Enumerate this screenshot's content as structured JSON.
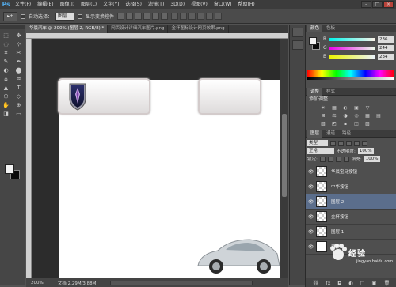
{
  "app": {
    "logo": "Ps",
    "menu": [
      "文件(F)",
      "编辑(E)",
      "图像(I)",
      "图层(L)",
      "文字(Y)",
      "选择(S)",
      "滤镜(T)",
      "3D(D)",
      "视图(V)",
      "窗口(W)",
      "帮助(H)"
    ],
    "window_buttons": [
      "–",
      "□",
      "×"
    ]
  },
  "options": {
    "tool_preset": "▸+",
    "auto_select_label": "自动选择：",
    "auto_select_value": "图层",
    "transform_label": "显示变换控件"
  },
  "tools": [
    "⬚",
    "✥",
    "◌",
    "⊹",
    "⌗",
    "✂",
    "✎",
    "✒",
    "◐",
    "⬤",
    "⌂",
    "♒",
    "▲",
    "T",
    "⬡",
    "◇",
    "✋",
    "⊕",
    "◨",
    "▭"
  ],
  "document": {
    "tabs": [
      {
        "label": "华晨汽车 @ 200% (图层 2, RGB/8) *",
        "active": true
      },
      {
        "label": "网页设计详细汽车图片.png",
        "active": false
      },
      {
        "label": "金杯图标设计网页效果.png",
        "active": false
      }
    ]
  },
  "status": {
    "zoom": "200%",
    "doc_size": "文档:2.29M/3.88M"
  },
  "panels": {
    "color": {
      "tabs": [
        "颜色",
        "色板"
      ],
      "rows": [
        {
          "key": "R",
          "value": "236",
          "gradient": "linear-gradient(90deg,#00f4ea,#fff4ea)"
        },
        {
          "key": "G",
          "value": "244",
          "gradient": "linear-gradient(90deg,#ec00ea,#ecffea)"
        },
        {
          "key": "B",
          "value": "234",
          "gradient": "linear-gradient(90deg,#ecf400,#ecf4ff)"
        }
      ]
    },
    "adjustments": {
      "tabs": [
        "调整",
        "样式"
      ],
      "title": "添加调整",
      "icons": [
        "☀",
        "▦",
        "◐",
        "▣",
        "▽",
        "",
        "⊞",
        "⚖",
        "◑",
        "◎",
        "▦",
        "▤",
        "▧",
        "◩",
        "▪",
        "◫",
        "▨",
        ""
      ]
    },
    "layers": {
      "tabs": [
        "图层",
        "通道",
        "路径"
      ],
      "filter_kind": "类型",
      "blend_mode": "正常",
      "opacity_label": "不透明度:",
      "opacity_value": "100%",
      "lock_label": "锁定:",
      "fill_label": "填充:",
      "fill_value": "100%",
      "items": [
        {
          "name": "华晨宝马按钮",
          "eye": "👁",
          "thumb": "checker",
          "selected": false
        },
        {
          "name": "中华按钮",
          "eye": "👁",
          "thumb": "checker",
          "selected": false
        },
        {
          "name": "图层 2",
          "eye": "👁",
          "thumb": "checker",
          "selected": true
        },
        {
          "name": "金杯按钮",
          "eye": "👁",
          "thumb": "checker",
          "selected": false
        },
        {
          "name": "图层 1",
          "eye": "👁",
          "thumb": "checker",
          "selected": false
        },
        {
          "name": "背景",
          "eye": "👁",
          "thumb": "white",
          "selected": false
        }
      ],
      "footer_icons": [
        "⛓",
        "fx",
        "◘",
        "◐",
        "▢",
        "▣",
        "🗑"
      ]
    }
  },
  "watermark": {
    "text": "经验",
    "sub": "jingyan.baidu.com"
  }
}
